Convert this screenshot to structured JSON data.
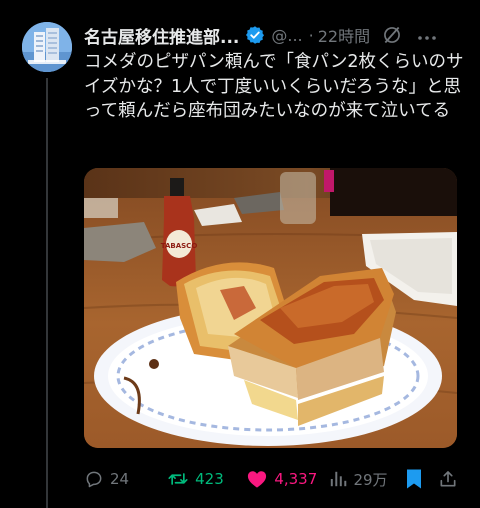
{
  "author": {
    "name": "名古屋移住推進部...",
    "handle": "@...",
    "separator": "·",
    "time": "22時間"
  },
  "tweet": {
    "text": "コメダのピザパン頼んで「食パン2枚くらいのサイズかな？1人で丁度いいくらいだろうな」と思って頼んだら座布団みたいなのが来て泣いてる"
  },
  "media": {
    "bottle_label": "TABASCO"
  },
  "actions": {
    "replies": "24",
    "retweets": "423",
    "likes": "4,337",
    "views": "29万"
  },
  "colors": {
    "background": "#000000",
    "text": "#e7e9ea",
    "muted": "#71767b",
    "verified": "#1d9bf0",
    "retweet": "#00ba7c",
    "like": "#f91880",
    "bookmark": "#1d9bf0"
  }
}
